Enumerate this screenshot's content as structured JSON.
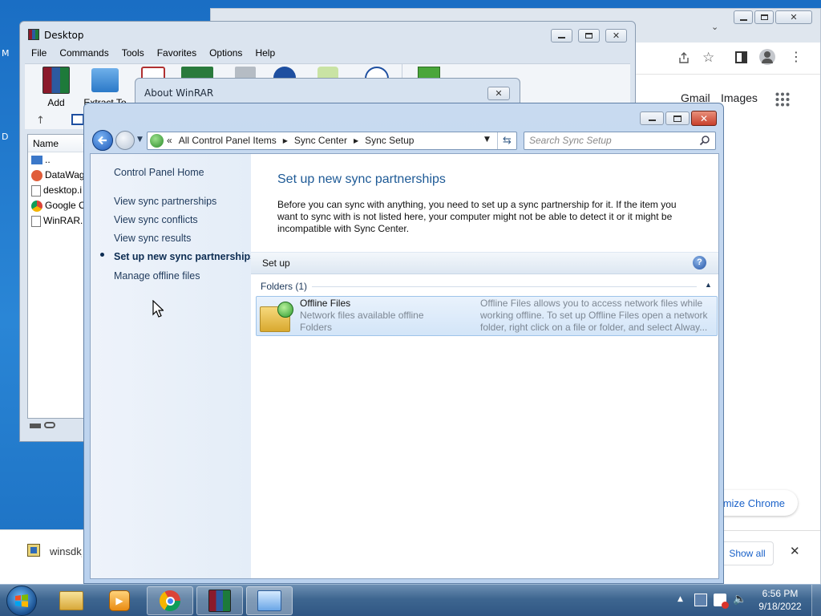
{
  "desktop": {
    "left_edge_letters": [
      "M",
      "D"
    ]
  },
  "chrome": {
    "links": {
      "gmail": "Gmail",
      "images": "Images"
    },
    "customize_button": "mize Chrome",
    "download": {
      "filename": "winsdk_",
      "show_all": "Show all"
    }
  },
  "winrar": {
    "title": "Desktop",
    "menu": [
      "File",
      "Commands",
      "Tools",
      "Favorites",
      "Options",
      "Help"
    ],
    "toolbar": {
      "add": "Add",
      "extract_to": "Extract To"
    },
    "list": {
      "header_name": "Name",
      "items": [
        "..",
        "DataWag",
        "desktop.i",
        "Google C",
        "WinRAR."
      ]
    }
  },
  "about_winrar": {
    "title": "About WinRAR"
  },
  "control_panel": {
    "breadcrumb": {
      "prefix": "«",
      "items": [
        "All Control Panel Items",
        "Sync Center",
        "Sync Setup"
      ]
    },
    "search_placeholder": "Search Sync Setup",
    "nav": {
      "home": "Control Panel Home",
      "links": [
        "View sync partnerships",
        "View sync conflicts",
        "View sync results",
        "Set up new sync partnerships",
        "Manage offline files"
      ],
      "selected_index": 3
    },
    "main": {
      "title": "Set up new sync partnerships",
      "description": "Before you can sync with anything, you need to set up a sync partnership for it. If the item you want to sync with is not listed here, your computer might not be able to detect it or it might be incompatible with Sync Center.",
      "setup_bar_label": "Set up",
      "group_header": "Folders (1)",
      "item": {
        "name": "Offline Files",
        "subtitle": "Network files available offline",
        "type": "Folders",
        "description": "Offline Files allows you to access network files while working offline. To set up Offline Files open a network folder, right click on a file or folder, and select Alway..."
      }
    }
  },
  "taskbar": {
    "apps": [
      "start-orb",
      "windows-explorer",
      "media-player",
      "chrome",
      "winrar",
      "control-panel"
    ],
    "active_app": "control-panel",
    "clock": {
      "time": "6:56 PM",
      "date": "9/18/2022"
    }
  },
  "colors": {
    "desktop_blue": "#1a6ec4",
    "link_blue": "#1e395b",
    "title_blue": "#1e5a96",
    "close_red": "#c8402c",
    "taskbar": "#3e6690"
  }
}
